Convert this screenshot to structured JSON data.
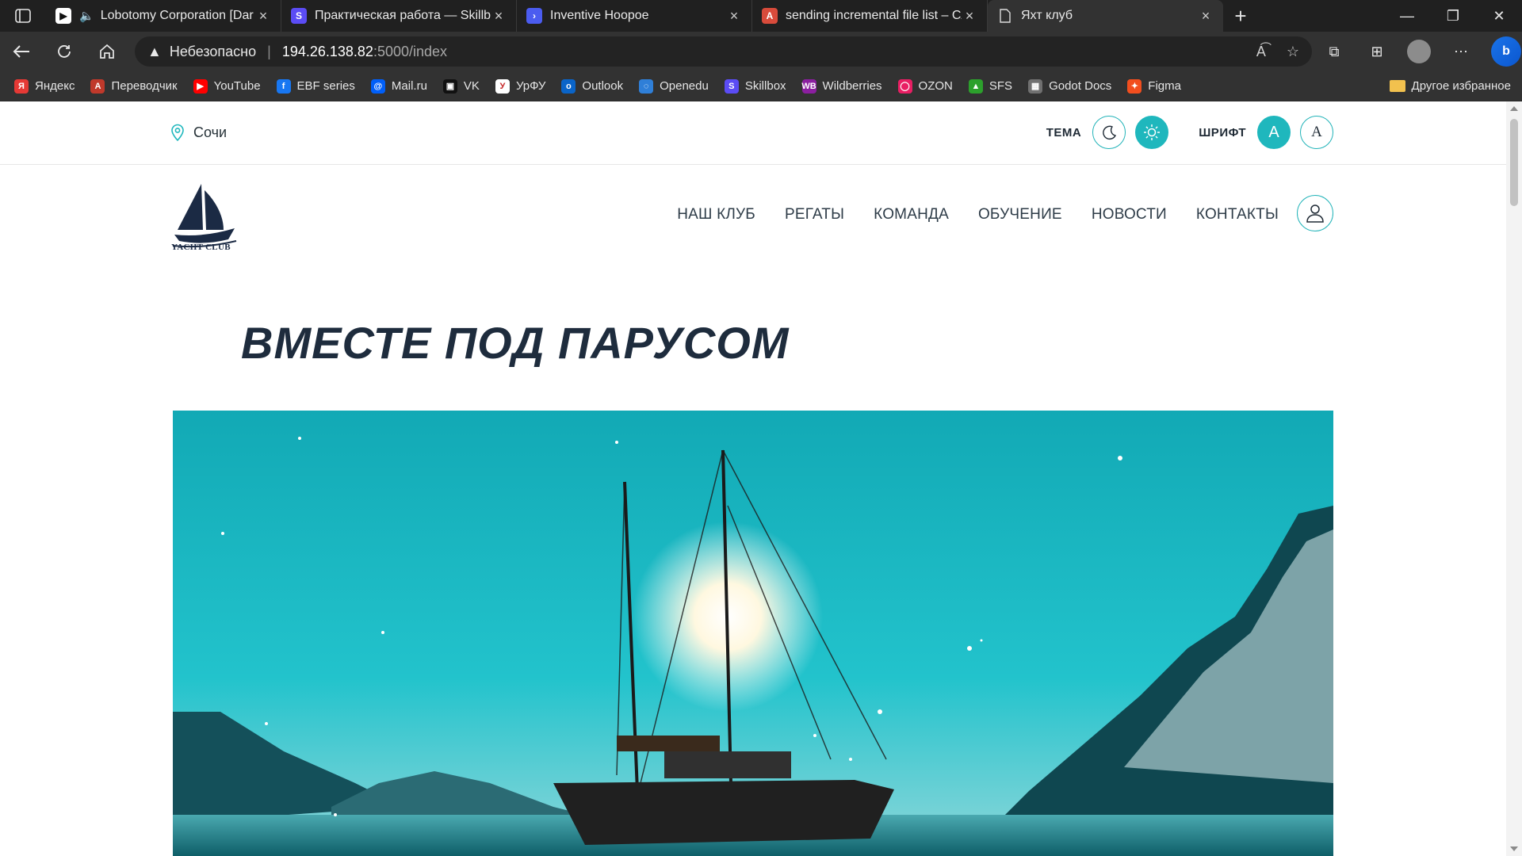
{
  "browser": {
    "tabs": [
      {
        "title": "Lobotomy Corporation [Dar",
        "favicon_color": "#111111",
        "active": false
      },
      {
        "title": "Практическая работа — Skillbo",
        "favicon_color": "#5b4cf5",
        "active": false
      },
      {
        "title": "Inventive Hoopoe",
        "favicon_color": "#4b5cf0",
        "active": false
      },
      {
        "title": "sending incremental file list – Сл",
        "favicon_color": "#d84b3b",
        "active": false
      },
      {
        "title": "Яхт клуб",
        "favicon_color": "#3a3a3a",
        "active": true
      }
    ],
    "new_tab_label": "+",
    "address": {
      "security_label": "Небезопасно",
      "host": "194.26.138.82",
      "path": ":5000/index"
    },
    "bookmarks": [
      {
        "label": "Яндекс",
        "color": "#e53935",
        "glyph": "Я"
      },
      {
        "label": "Переводчик",
        "color": "#c0392b",
        "glyph": "A"
      },
      {
        "label": "YouTube",
        "color": "#ff0000",
        "glyph": "▶"
      },
      {
        "label": "EBF series",
        "color": "#1877f2",
        "glyph": "f"
      },
      {
        "label": "Mail.ru",
        "color": "#005ff9",
        "glyph": "@"
      },
      {
        "label": "VK",
        "color": "#111111",
        "glyph": "▣"
      },
      {
        "label": "УрФУ",
        "color": "#ffffff",
        "glyph": "У"
      },
      {
        "label": "Outlook",
        "color": "#0a64c8",
        "glyph": "o"
      },
      {
        "label": "Openedu",
        "color": "#2f7fd8",
        "glyph": "◌"
      },
      {
        "label": "Skillbox",
        "color": "#5b4cf5",
        "glyph": "S"
      },
      {
        "label": "Wildberries",
        "color": "#8b1fa0",
        "glyph": "WB"
      },
      {
        "label": "OZON",
        "color": "#e91e63",
        "glyph": "◯"
      },
      {
        "label": "SFS",
        "color": "#2ca02c",
        "glyph": "▲"
      },
      {
        "label": "Godot Docs",
        "color": "#707070",
        "glyph": "▦"
      },
      {
        "label": "Figma",
        "color": "#f24e1e",
        "glyph": "✦"
      }
    ],
    "other_bookmarks_label": "Другое избранное"
  },
  "site": {
    "accent_color": "#1fb7bd",
    "city": "Сочи",
    "theme_label": "ТЕМА",
    "font_label": "ШРИФТ",
    "font_option_sans": "A",
    "font_option_serif": "A",
    "logo_text": "YACHT CLUB",
    "menu": [
      {
        "label": "НАШ КЛУБ"
      },
      {
        "label": "РЕГАТЫ"
      },
      {
        "label": "КОМАНДА"
      },
      {
        "label": "ОБУЧЕНИЕ"
      },
      {
        "label": "НОВОСТИ"
      },
      {
        "label": "КОНТАКТЫ"
      }
    ],
    "hero_title": "ВМЕСТЕ ПОД ПАРУСОМ"
  }
}
